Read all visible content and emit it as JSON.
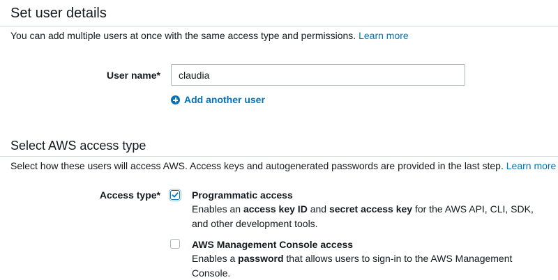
{
  "user_details": {
    "title": "Set user details",
    "description": "You can add multiple users at once with the same access type and permissions.",
    "learn_more": "Learn more",
    "username_label": "User name*",
    "username_value": "claudia",
    "add_user_label": "Add another user"
  },
  "access_type": {
    "title": "Select AWS access type",
    "description": "Select how these users will access AWS. Access keys and autogenerated passwords are provided in the last step.",
    "learn_more": "Learn more",
    "label": "Access type*",
    "options": [
      {
        "title": "Programmatic access",
        "checked": true,
        "desc_parts": [
          "Enables an ",
          "access key ID",
          " and ",
          "secret access key",
          " for the AWS API, CLI, SDK, and other development tools."
        ]
      },
      {
        "title": "AWS Management Console access",
        "checked": false,
        "desc_parts": [
          "Enables a ",
          "password",
          " that allows users to sign-in to the AWS Management Console."
        ]
      }
    ]
  },
  "colors": {
    "link": "#0073bb",
    "divider": "#d5dbdb",
    "text": "#16191f"
  },
  "icons": {
    "add": "plus-circle-icon",
    "check": "checkmark-icon"
  }
}
